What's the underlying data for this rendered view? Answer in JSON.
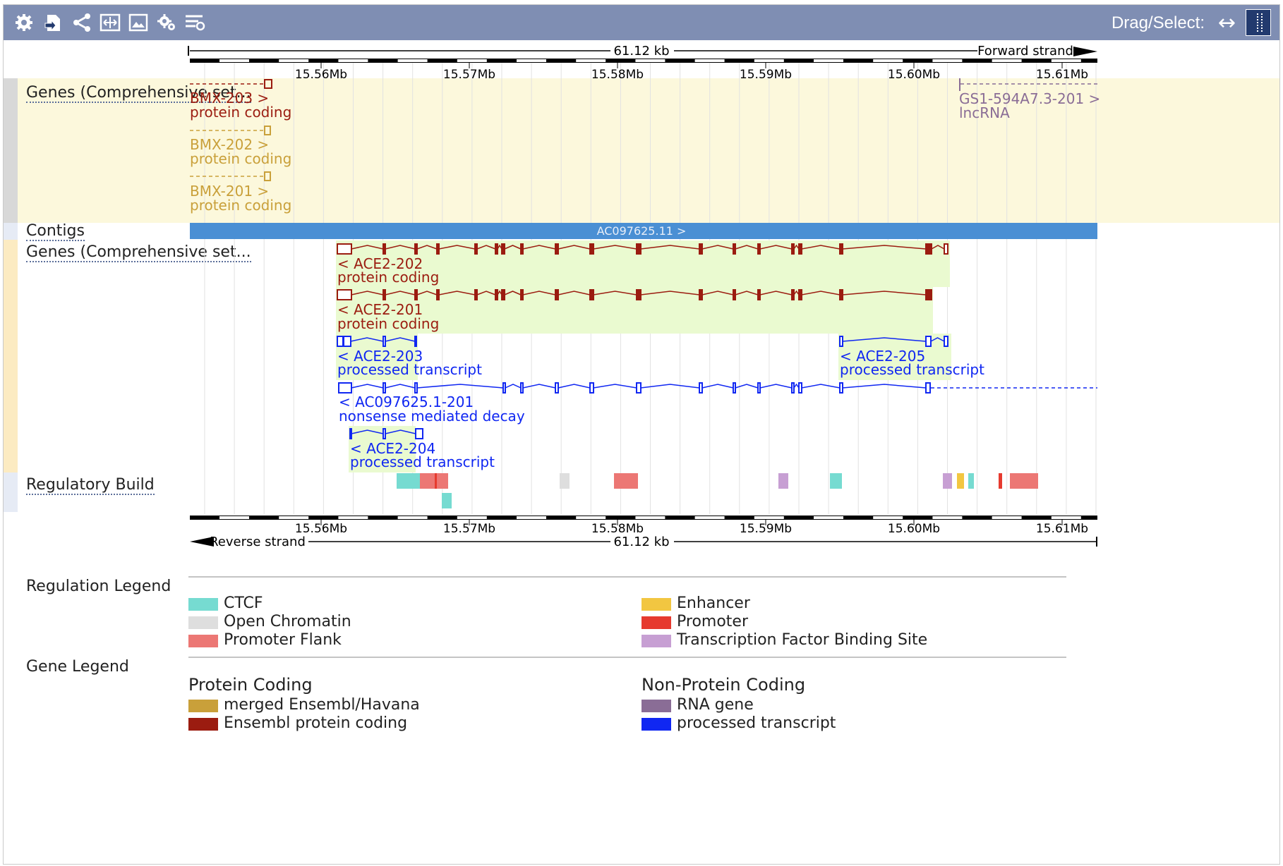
{
  "toolbar": {
    "icons": [
      "settings-icon",
      "export-icon",
      "share-icon",
      "resize-icon",
      "image-icon",
      "track-config-icon",
      "tracks-icon"
    ],
    "drag_select_label": "Drag/Select:",
    "drag_mode_icon": "horizontal-arrow-icon",
    "select_mode_icon": "dotted-select-icon"
  },
  "ruler_top": {
    "length_label": "61.12 kb",
    "strand_label": "Forward strand",
    "ticks": [
      "15.56Mb",
      "15.57Mb",
      "15.58Mb",
      "15.59Mb",
      "15.60Mb",
      "15.61Mb"
    ]
  },
  "tracks": {
    "forward_genes": {
      "label": "Genes (Comprehensive set...",
      "transcripts": [
        {
          "name": "BMX-203 >",
          "biotype": "protein coding"
        },
        {
          "name": "BMX-202 >",
          "biotype": "protein coding"
        },
        {
          "name": "BMX-201 >",
          "biotype": "protein coding"
        },
        {
          "name": "GS1-594A7.3-201 >",
          "biotype": "lncRNA"
        }
      ]
    },
    "contigs": {
      "label": "Contigs",
      "contig_name": "AC097625.11 >"
    },
    "reverse_genes": {
      "label": "Genes (Comprehensive set...",
      "transcripts": [
        {
          "name": "< ACE2-202",
          "biotype": "protein coding"
        },
        {
          "name": "< ACE2-201",
          "biotype": "protein coding"
        },
        {
          "name": "< ACE2-203",
          "biotype": "processed transcript"
        },
        {
          "name": "< ACE2-205",
          "biotype": "processed transcript"
        },
        {
          "name": "< AC097625.1-201",
          "biotype": "nonsense mediated decay"
        },
        {
          "name": "< ACE2-204",
          "biotype": "processed transcript"
        }
      ]
    },
    "regulatory": {
      "label": "Regulatory Build"
    }
  },
  "ruler_bottom": {
    "length_label": "61.12 kb",
    "strand_label": "Reverse strand",
    "ticks": [
      "15.56Mb",
      "15.57Mb",
      "15.58Mb",
      "15.59Mb",
      "15.60Mb",
      "15.61Mb"
    ]
  },
  "regulation_legend": {
    "title": "Regulation Legend",
    "items": [
      {
        "label": "CTCF",
        "color": "#76dbd1"
      },
      {
        "label": "Open Chromatin",
        "color": "#dedede"
      },
      {
        "label": "Promoter Flank",
        "color": "#ec7774"
      },
      {
        "label": "Enhancer",
        "color": "#f2c641"
      },
      {
        "label": "Promoter",
        "color": "#e63a2f"
      },
      {
        "label": "Transcription Factor Binding Site",
        "color": "#c79fd3"
      }
    ]
  },
  "gene_legend": {
    "title": "Gene Legend",
    "protein_coding_title": "Protein Coding",
    "non_protein_coding_title": "Non-Protein Coding",
    "items": [
      {
        "label": "merged Ensembl/Havana",
        "color": "#c9a03a"
      },
      {
        "label": "Ensembl protein coding",
        "color": "#9b1c10"
      },
      {
        "label": "RNA gene",
        "color": "#8a6d96"
      },
      {
        "label": "processed transcript",
        "color": "#1027f2"
      }
    ]
  },
  "colors": {
    "toolbar": "#7f8eb3",
    "havana_gold": "#c9a03a",
    "ensembl_red": "#9b1c10",
    "processed_blue": "#1027f2",
    "lncrna_brown": "#8a6d96",
    "contig_blue": "#4a8fd4"
  }
}
